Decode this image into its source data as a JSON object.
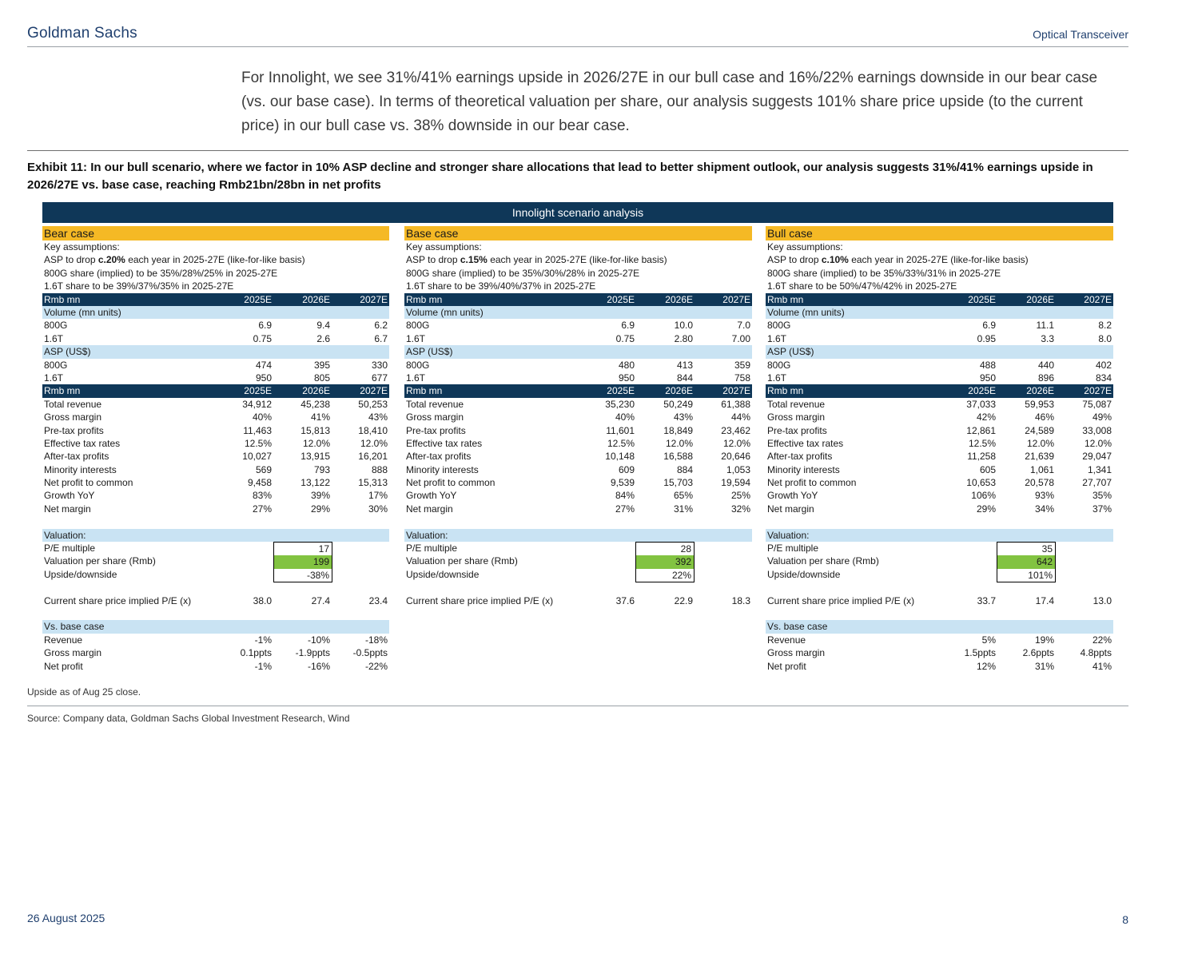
{
  "header": {
    "brand": "Goldman Sachs",
    "section": "Optical Transceiver"
  },
  "intro": "For Innolight, we see 31%/41% earnings upside in 2026/27E in our bull case and 16%/22% earnings downside in our bear case (vs. our base case). In terms of theoretical valuation per share, our analysis suggests 101% share price upside (to the current price) in our bull case vs. 38% downside in our bear case.",
  "exhibit_title": "Exhibit 11: In our bull scenario, where we factor in 10% ASP decline and stronger share allocations that lead to better shipment outlook, our analysis suggests 31%/41% earnings upside in 2026/27E vs. base case, reaching Rmb21bn/28bn in net profits",
  "table_title": "Innolight scenario analysis",
  "cases": [
    {
      "title": "Bear case",
      "assumptions": {
        "heading": "Key assumptions:",
        "asp_pre": "ASP to drop ",
        "asp_bold": "c.20%",
        "asp_post": " each year in 2025-27E (like-for-like basis)",
        "share_800g": "800G share (implied) to be 35%/28%/25% in 2025-27E",
        "share_16t": "1.6T share to be 39%/37%/35% in 2025-27E"
      },
      "unit_header": "Rmb mn",
      "years": [
        "2025E",
        "2026E",
        "2027E"
      ],
      "volume_label": "Volume (mn units)",
      "volume": [
        [
          "800G",
          "6.9",
          "9.4",
          "6.2"
        ],
        [
          "1.6T",
          "0.75",
          "2.6",
          "6.7"
        ]
      ],
      "asp_label": "ASP (US$)",
      "asp": [
        [
          "800G",
          "474",
          "395",
          "330"
        ],
        [
          "1.6T",
          "950",
          "805",
          "677"
        ]
      ],
      "pl": [
        [
          "Total revenue",
          "34,912",
          "45,238",
          "50,253"
        ],
        [
          "Gross margin",
          "40%",
          "41%",
          "43%"
        ],
        [
          "Pre-tax profits",
          "11,463",
          "15,813",
          "18,410"
        ],
        [
          "Effective tax rates",
          "12.5%",
          "12.0%",
          "12.0%"
        ],
        [
          "After-tax profits",
          "10,027",
          "13,915",
          "16,201"
        ],
        [
          "Minority interests",
          "569",
          "793",
          "888"
        ],
        [
          "Net profit to common",
          "9,458",
          "13,122",
          "15,313"
        ],
        [
          "Growth YoY",
          "83%",
          "39%",
          "17%"
        ],
        [
          "Net margin",
          "27%",
          "29%",
          "30%"
        ]
      ],
      "valuation_label": "Valuation:",
      "valuation_rows": [
        "P/E multiple",
        "Valuation per share (Rmb)",
        "Upside/downside"
      ],
      "valuation_values": [
        "17",
        "199",
        "-38%"
      ],
      "implied_pe": [
        "Current share price implied P/E (x)",
        "38.0",
        "27.4",
        "23.4"
      ],
      "vs_base_label": "Vs. base case",
      "vs_base": [
        [
          "Revenue",
          "-1%",
          "-10%",
          "-18%"
        ],
        [
          "Gross margin",
          "0.1ppts",
          "-1.9ppts",
          "-0.5ppts"
        ],
        [
          "Net profit",
          "-1%",
          "-16%",
          "-22%"
        ]
      ]
    },
    {
      "title": "Base case",
      "assumptions": {
        "heading": "Key assumptions:",
        "asp_pre": "ASP to drop ",
        "asp_bold": "c.15%",
        "asp_post": " each year in 2025-27E (like-for-like basis)",
        "share_800g": "800G share (implied) to be 35%/30%/28% in 2025-27E",
        "share_16t": "1.6T share to be 39%/40%/37% in 2025-27E"
      },
      "unit_header": "Rmb mn",
      "years": [
        "2025E",
        "2026E",
        "2027E"
      ],
      "volume_label": "Volume (mn units)",
      "volume": [
        [
          "800G",
          "6.9",
          "10.0",
          "7.0"
        ],
        [
          "1.6T",
          "0.75",
          "2.80",
          "7.00"
        ]
      ],
      "asp_label": "ASP (US$)",
      "asp": [
        [
          "800G",
          "480",
          "413",
          "359"
        ],
        [
          "1.6T",
          "950",
          "844",
          "758"
        ]
      ],
      "pl": [
        [
          "Total revenue",
          "35,230",
          "50,249",
          "61,388"
        ],
        [
          "Gross margin",
          "40%",
          "43%",
          "44%"
        ],
        [
          "Pre-tax profits",
          "11,601",
          "18,849",
          "23,462"
        ],
        [
          "Effective tax rates",
          "12.5%",
          "12.0%",
          "12.0%"
        ],
        [
          "After-tax profits",
          "10,148",
          "16,588",
          "20,646"
        ],
        [
          "Minority interests",
          "609",
          "884",
          "1,053"
        ],
        [
          "Net profit to common",
          "9,539",
          "15,703",
          "19,594"
        ],
        [
          "Growth YoY",
          "84%",
          "65%",
          "25%"
        ],
        [
          "Net margin",
          "27%",
          "31%",
          "32%"
        ]
      ],
      "valuation_label": "Valuation:",
      "valuation_rows": [
        "P/E multiple",
        "Valuation per share (Rmb)",
        "Upside/downside"
      ],
      "valuation_values": [
        "28",
        "392",
        "22%"
      ],
      "implied_pe": [
        "Current share price implied P/E (x)",
        "37.6",
        "22.9",
        "18.3"
      ]
    },
    {
      "title": "Bull case",
      "assumptions": {
        "heading": "Key assumptions:",
        "asp_pre": "ASP to drop ",
        "asp_bold": "c.10%",
        "asp_post": " each year in 2025-27E (like-for-like basis)",
        "share_800g": "800G share (implied) to be 35%/33%/31% in 2025-27E",
        "share_16t": "1.6T share to be 50%/47%/42% in 2025-27E"
      },
      "unit_header": "Rmb mn",
      "years": [
        "2025E",
        "2026E",
        "2027E"
      ],
      "volume_label": "Volume (mn units)",
      "volume": [
        [
          "800G",
          "6.9",
          "11.1",
          "8.2"
        ],
        [
          "1.6T",
          "0.95",
          "3.3",
          "8.0"
        ]
      ],
      "asp_label": "ASP (US$)",
      "asp": [
        [
          "800G",
          "488",
          "440",
          "402"
        ],
        [
          "1.6T",
          "950",
          "896",
          "834"
        ]
      ],
      "pl": [
        [
          "Total revenue",
          "37,033",
          "59,953",
          "75,087"
        ],
        [
          "Gross margin",
          "42%",
          "46%",
          "49%"
        ],
        [
          "Pre-tax profits",
          "12,861",
          "24,589",
          "33,008"
        ],
        [
          "Effective tax rates",
          "12.5%",
          "12.0%",
          "12.0%"
        ],
        [
          "After-tax profits",
          "11,258",
          "21,639",
          "29,047"
        ],
        [
          "Minority interests",
          "605",
          "1,061",
          "1,341"
        ],
        [
          "Net profit to common",
          "10,653",
          "20,578",
          "27,707"
        ],
        [
          "Growth YoY",
          "106%",
          "93%",
          "35%"
        ],
        [
          "Net margin",
          "29%",
          "34%",
          "37%"
        ]
      ],
      "valuation_label": "Valuation:",
      "valuation_rows": [
        "P/E multiple",
        "Valuation per share (Rmb)",
        "Upside/downside"
      ],
      "valuation_values": [
        "35",
        "642",
        "101%"
      ],
      "implied_pe": [
        "Current share price implied P/E (x)",
        "33.7",
        "17.4",
        "13.0"
      ],
      "vs_base_label": "Vs. base case",
      "vs_base": [
        [
          "Revenue",
          "5%",
          "19%",
          "22%"
        ],
        [
          "Gross margin",
          "1.5ppts",
          "2.6ppts",
          "4.8ppts"
        ],
        [
          "Net profit",
          "12%",
          "31%",
          "41%"
        ]
      ]
    }
  ],
  "note": "Upside as of Aug 25 close.",
  "source": "Source: Company data, Goldman Sachs Global Investment Research, Wind",
  "footer": {
    "date": "26 August 2025",
    "page": "8"
  }
}
